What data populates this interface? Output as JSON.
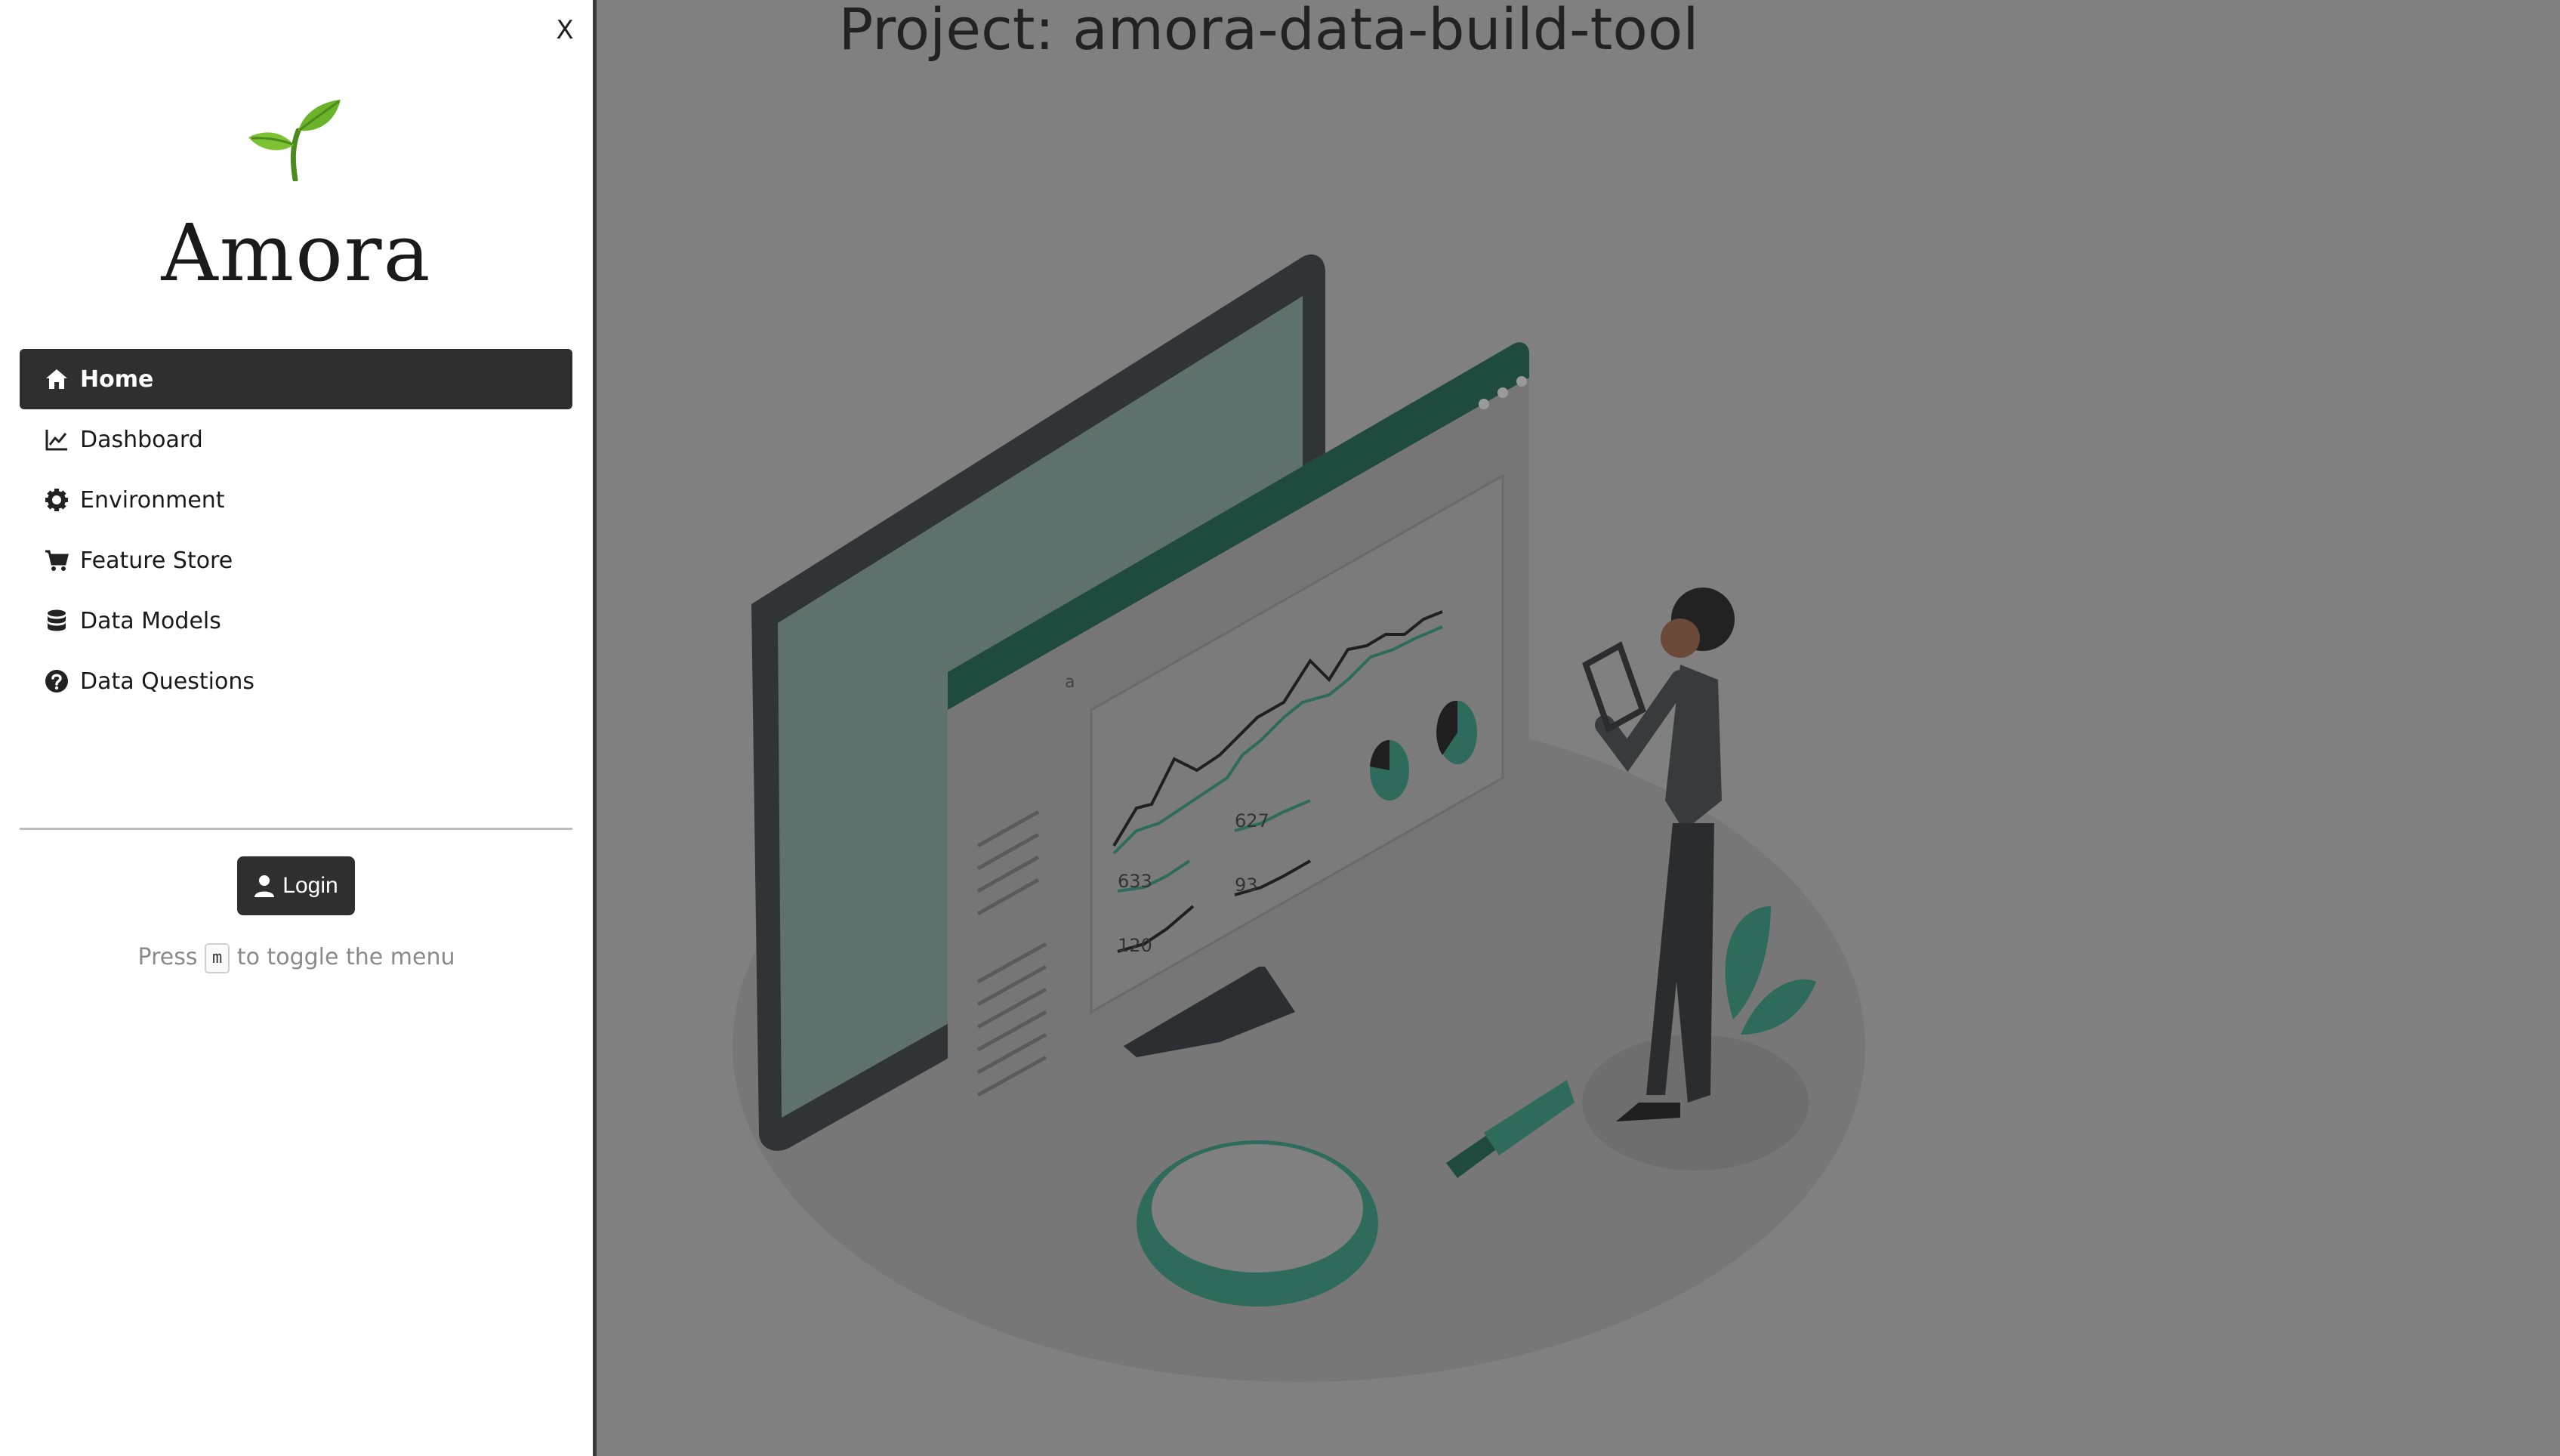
{
  "sidebar": {
    "close_label": "X",
    "brand": "Amora",
    "nav": [
      {
        "label": "Home",
        "icon": "home-icon",
        "active": true
      },
      {
        "label": "Dashboard",
        "icon": "line-chart-icon",
        "active": false
      },
      {
        "label": "Environment",
        "icon": "gear-icon",
        "active": false
      },
      {
        "label": "Feature Store",
        "icon": "cart-icon",
        "active": false
      },
      {
        "label": "Data Models",
        "icon": "database-icon",
        "active": false
      },
      {
        "label": "Data Questions",
        "icon": "question-circle-icon",
        "active": false
      }
    ],
    "login_label": "Login",
    "hint": {
      "before": "Press",
      "key": "m",
      "after": "to toggle the menu"
    }
  },
  "main": {
    "title": "Project: amora-data-build-tool",
    "illustration": {
      "card_numbers": [
        "627",
        "633",
        "93",
        "120"
      ],
      "letter": "a"
    }
  },
  "colors": {
    "overlay": "#808080",
    "sidebar_bg": "#ffffff",
    "active_nav": "#2f2f2f",
    "accent_green": "#2e6b5c",
    "dark_green": "#1f4a3f"
  }
}
